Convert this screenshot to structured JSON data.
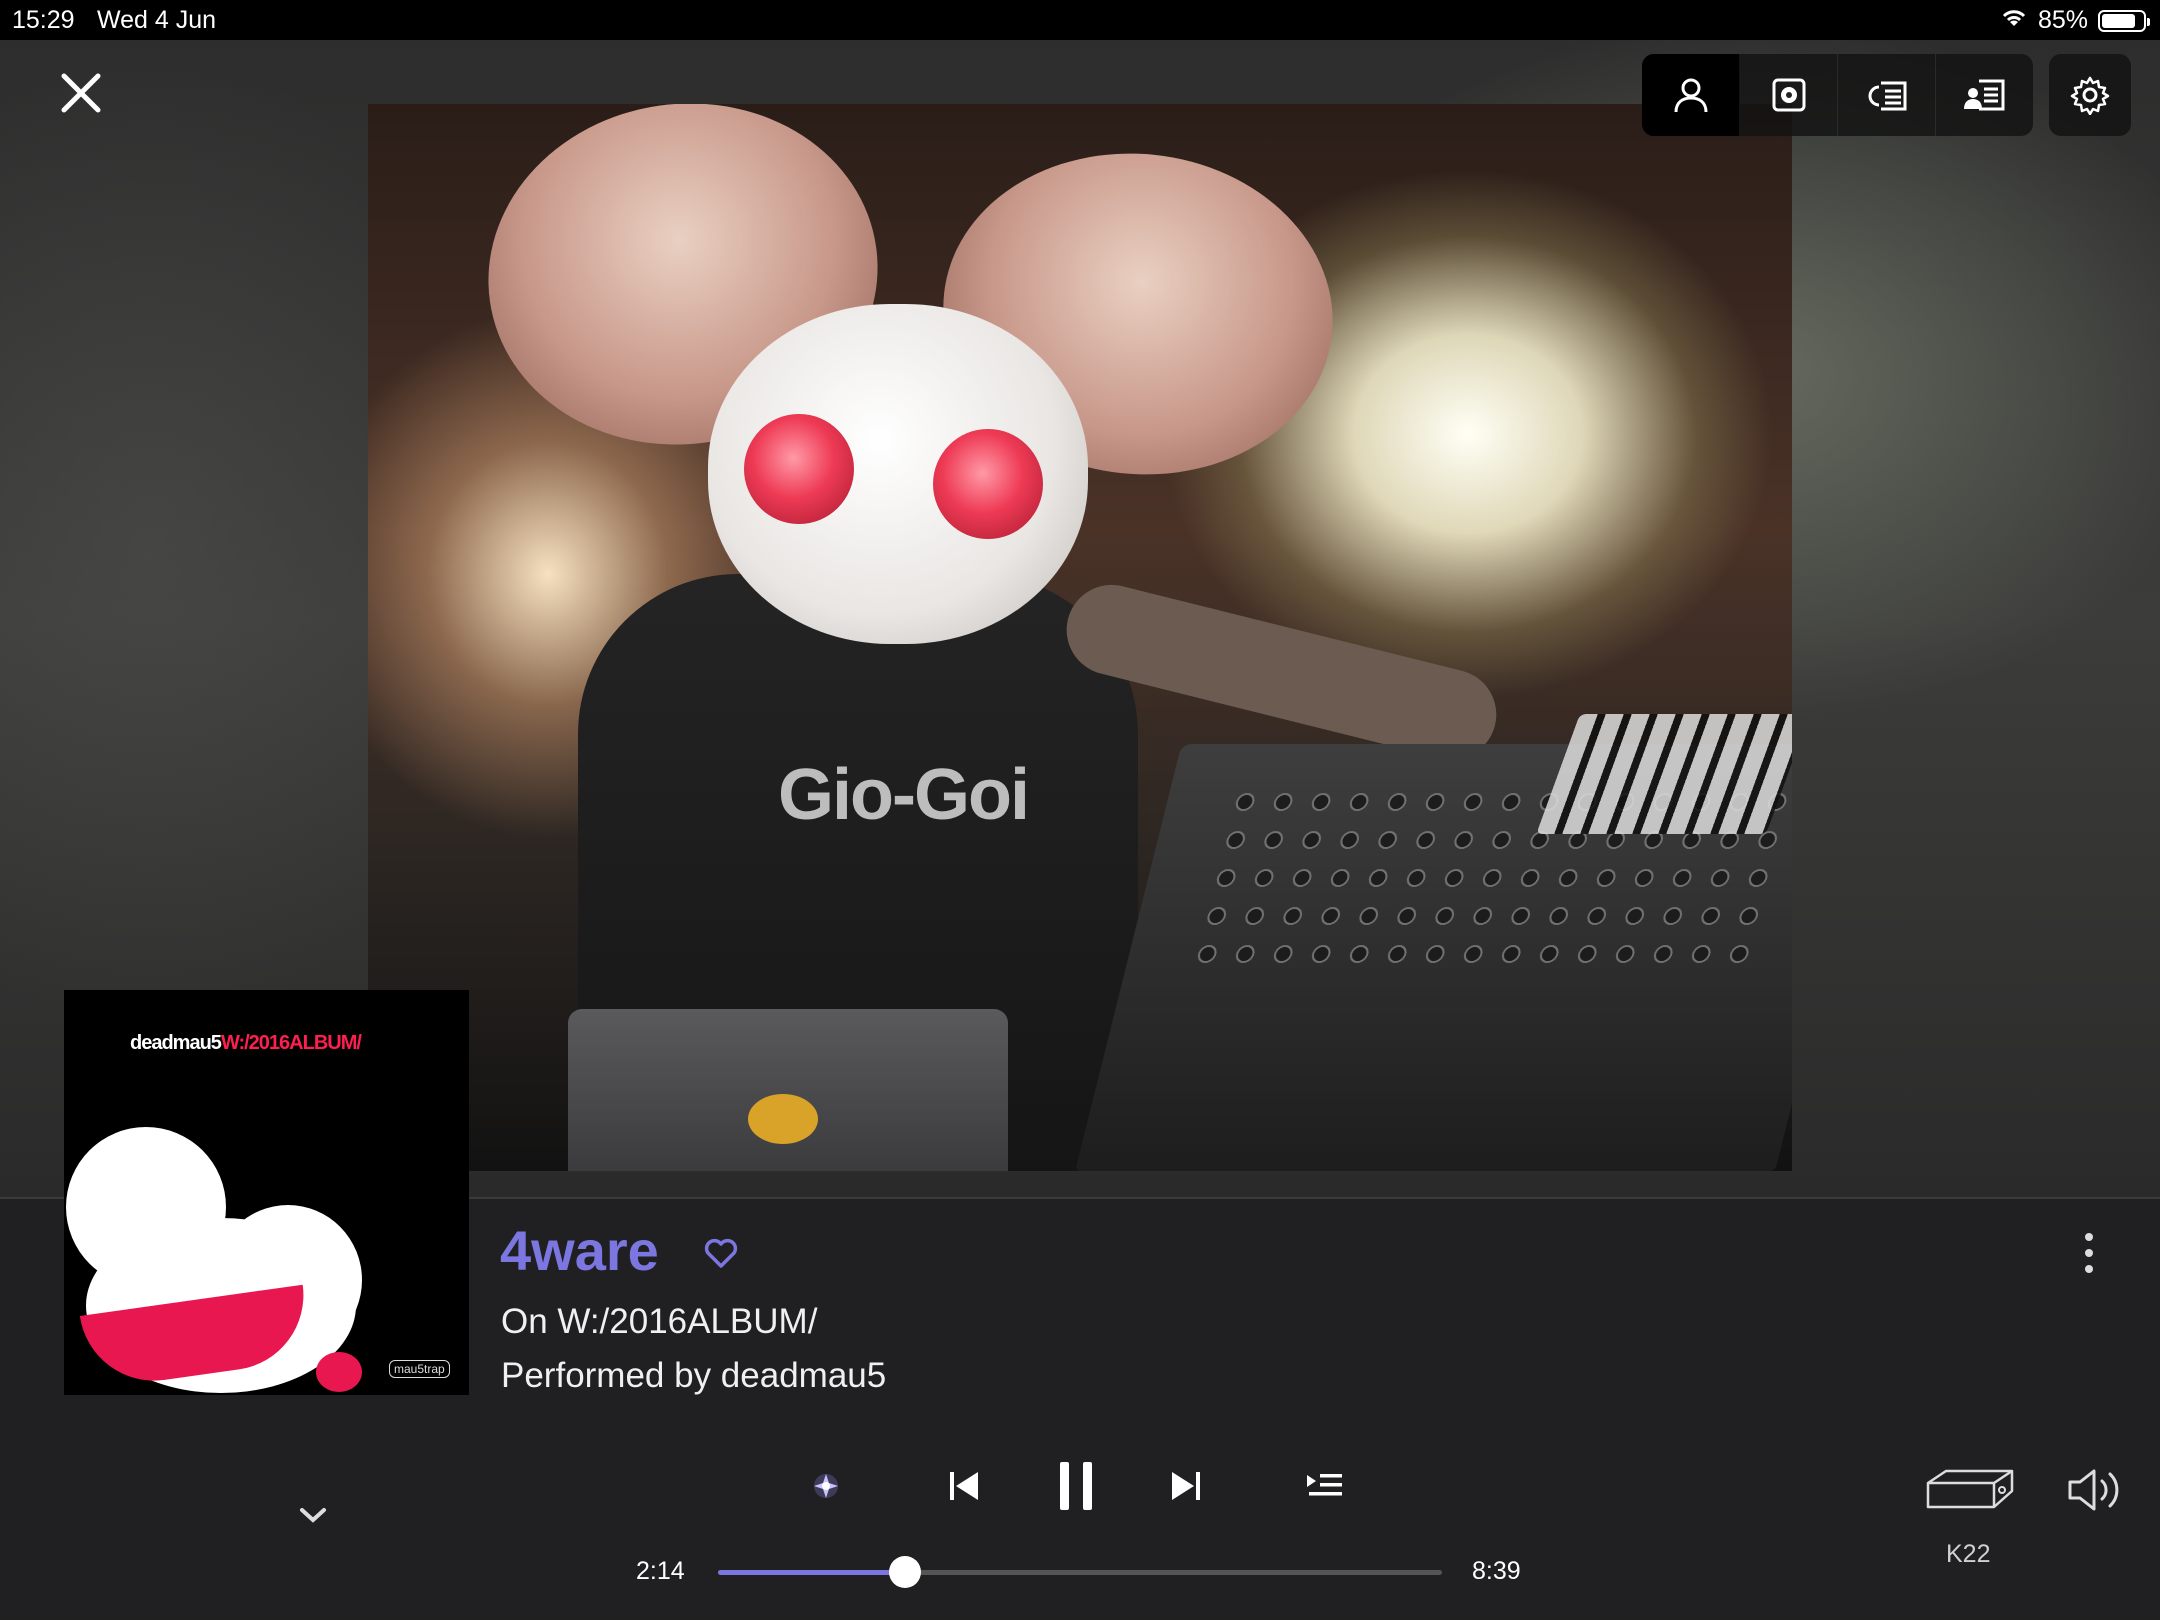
{
  "status_bar": {
    "time": "15:29",
    "date": "Wed 4 Jun",
    "battery_text": "85%",
    "battery_level": 0.85
  },
  "toolbar": {
    "buttons": [
      {
        "icon": "artist-icon",
        "active": true
      },
      {
        "icon": "album-icon",
        "active": false
      },
      {
        "icon": "lyrics-icon",
        "active": false
      },
      {
        "icon": "info-icon",
        "active": false
      }
    ],
    "settings_icon": "gear-icon"
  },
  "artwork": {
    "cover_title_artist": "deadmau5",
    "cover_title_album": "W:/2016ALBUM/",
    "cover_label": "mau5trap"
  },
  "track": {
    "title": "4ware",
    "album_line": "On W:/2016ALBUM/",
    "artist_line": "Performed by deadmau5",
    "accent_color": "#7b76e0"
  },
  "playback": {
    "elapsed": "2:14",
    "total": "8:39",
    "progress": 0.258,
    "state": "playing"
  },
  "output": {
    "device_name": "K22"
  }
}
